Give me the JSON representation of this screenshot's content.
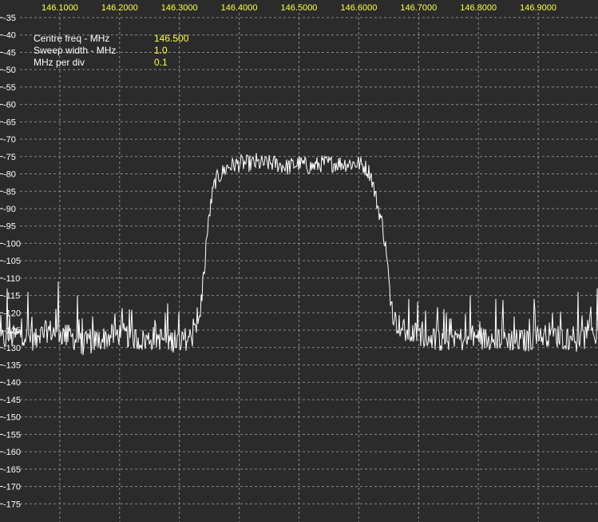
{
  "info": {
    "centre_freq_label": "Centre freq - MHz",
    "centre_freq_value": "146.500",
    "sweep_width_label": "Sweep width - MHz",
    "sweep_width_value": "1.0",
    "mhz_per_div_label": "MHz per div",
    "mhz_per_div_value": "0.1"
  },
  "colors": {
    "background": "#2b2b2b",
    "grid": "#8a8a8a",
    "trace": "#ffffff",
    "freq_labels": "#ffff40",
    "level_labels": "#ffffff"
  },
  "chart_data": {
    "type": "line",
    "title": "",
    "xlabel": "",
    "ylabel": "",
    "grid": true,
    "legend": "none",
    "xlim": [
      146.0,
      147.0
    ],
    "ylim": [
      -178,
      -34
    ],
    "x_ticks": [
      "146.1000",
      "146.2000",
      "146.3000",
      "146.4000",
      "146.5000",
      "146.6000",
      "146.7000",
      "146.8000",
      "146.9000"
    ],
    "y_ticks": [
      -35,
      -40,
      -45,
      -50,
      -55,
      -60,
      -65,
      -70,
      -75,
      -80,
      -85,
      -90,
      -95,
      -100,
      -105,
      -110,
      -115,
      -120,
      -125,
      -130,
      -135,
      -140,
      -145,
      -150,
      -155,
      -160,
      -165,
      -170,
      -175
    ],
    "series": [
      {
        "values": {
          "x": [
            146.0,
            146.02,
            146.04,
            146.06,
            146.08,
            146.1,
            146.12,
            146.14,
            146.16,
            146.18,
            146.2,
            146.22,
            146.24,
            146.26,
            146.28,
            146.3,
            146.32,
            146.33,
            146.335,
            146.34,
            146.345,
            146.35,
            146.355,
            146.36,
            146.37,
            146.38,
            146.4,
            146.42,
            146.44,
            146.46,
            146.48,
            146.5,
            146.52,
            146.54,
            146.56,
            146.58,
            146.6,
            146.61,
            146.62,
            146.63,
            146.64,
            146.645,
            146.65,
            146.655,
            146.66,
            146.67,
            146.68,
            146.7,
            146.72,
            146.74,
            146.76,
            146.78,
            146.8,
            146.82,
            146.84,
            146.86,
            146.88,
            146.9,
            146.92,
            146.94,
            146.96,
            146.98,
            147.0
          ],
          "y": [
            -128,
            -127,
            -126,
            -128,
            -125,
            -126,
            -127,
            -129,
            -128,
            -127,
            -126,
            -127,
            -128,
            -127,
            -128,
            -128,
            -127,
            -125,
            -120,
            -110,
            -100,
            -92,
            -86,
            -82,
            -80,
            -78,
            -77,
            -77,
            -77,
            -77,
            -78,
            -77,
            -78,
            -77,
            -77,
            -77,
            -77,
            -78,
            -80,
            -88,
            -95,
            -102,
            -110,
            -118,
            -122,
            -124,
            -126,
            -126,
            -127,
            -128,
            -127,
            -128,
            -127,
            -128,
            -127,
            -128,
            -128,
            -127,
            -126,
            -127,
            -128,
            -127,
            -126
          ]
        },
        "spurs": [
          {
            "x": 146.012,
            "y": -113
          },
          {
            "x": 146.047,
            "y": -114
          },
          {
            "x": 146.097,
            "y": -111
          },
          {
            "x": 146.129,
            "y": -115
          },
          {
            "x": 146.216,
            "y": -119
          },
          {
            "x": 146.428,
            "y": -74
          },
          {
            "x": 146.683,
            "y": -116
          },
          {
            "x": 146.786,
            "y": -115
          },
          {
            "x": 146.829,
            "y": -116
          },
          {
            "x": 146.893,
            "y": -116
          },
          {
            "x": 146.966,
            "y": -114
          },
          {
            "x": 146.998,
            "y": -113
          }
        ]
      }
    ]
  }
}
